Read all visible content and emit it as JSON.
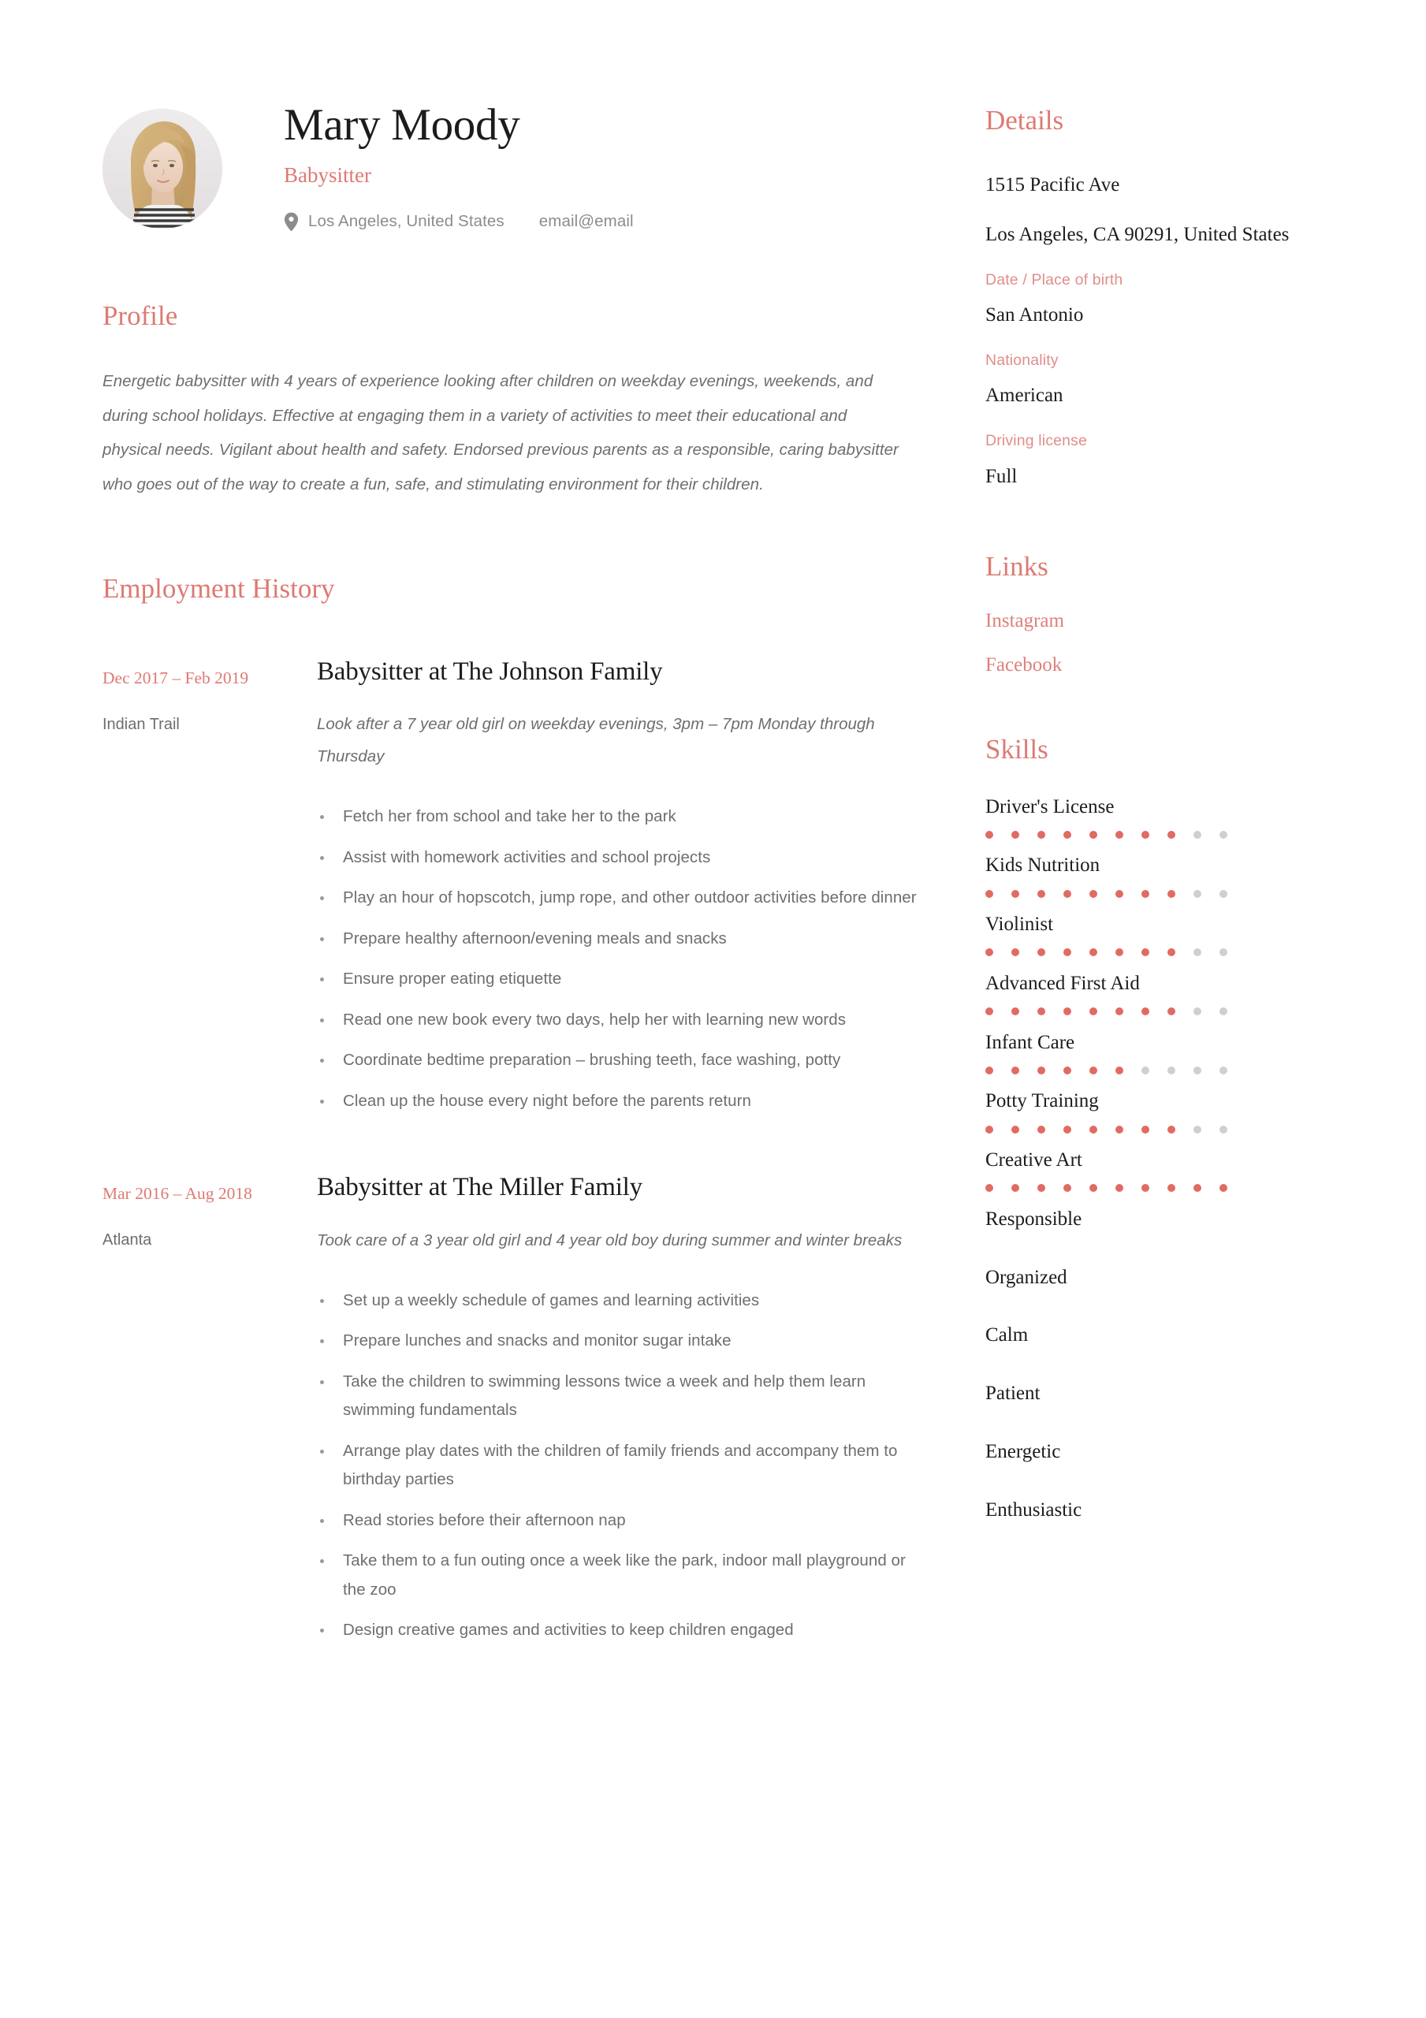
{
  "theme": {
    "accent": "#dd7a72",
    "accent_dot": "#e06b62",
    "dot_empty": "#cfcfcf",
    "text_dark": "#1c1c1c",
    "text_muted": "#6e6e6e"
  },
  "header": {
    "name": "Mary Moody",
    "job_title": "Babysitter",
    "location": "Los Angeles, United States",
    "email": "email@email",
    "location_icon": "map-pin-icon",
    "avatar_alt": "portrait-photo"
  },
  "profile": {
    "heading": "Profile",
    "body": "Energetic babysitter with 4 years of experience looking after children on weekday evenings, weekends, and during school holidays. Effective at engaging them in a variety of activities to meet their educational and physical needs. Vigilant about health and safety. Endorsed previous parents as a responsible, caring babysitter who goes out of the way to create a fun, safe, and stimulating environment for their children."
  },
  "employment": {
    "heading": "Employment History",
    "jobs": [
      {
        "dates": "Dec 2017 – Feb 2019",
        "location": "Indian Trail",
        "title": "Babysitter at The Johnson Family",
        "summary": "Look after a 7 year old girl on weekday evenings, 3pm – 7pm Monday through Thursday",
        "bullets": [
          "Fetch her from school and take her to the park",
          "Assist with homework activities and school projects",
          "Play an hour of hopscotch, jump rope, and other outdoor activities before dinner",
          "Prepare healthy afternoon/evening meals and snacks",
          "Ensure proper eating etiquette",
          "Read one new book every two days, help her with learning new words",
          "Coordinate bedtime preparation – brushing teeth, face washing, potty",
          "Clean up the house every night before the parents return"
        ]
      },
      {
        "dates": "Mar 2016 – Aug 2018",
        "location": "Atlanta",
        "title": "Babysitter at The Miller Family",
        "summary": "Took care of a 3 year old girl and 4 year old boy during summer and winter breaks",
        "bullets": [
          "Set up a weekly schedule of games and learning activities",
          "Prepare lunches and snacks and monitor sugar intake",
          "Take the children to swimming lessons twice a week and help them learn swimming fundamentals",
          "Arrange play dates with the children of family friends and accompany them to birthday parties",
          "Read stories before their afternoon nap",
          "Take them to a fun outing once a week like the park, indoor mall playground or the zoo",
          "Design creative games and activities to keep children engaged"
        ]
      }
    ]
  },
  "details": {
    "heading": "Details",
    "address_line1": "1515 Pacific Ave",
    "address_line2": "Los Angeles, CA 90291, United States",
    "dob_label": "Date / Place of birth",
    "dob_value": "San Antonio",
    "nationality_label": "Nationality",
    "nationality_value": "American",
    "license_label": "Driving license",
    "license_value": "Full"
  },
  "links": {
    "heading": "Links",
    "items": [
      {
        "label": "Instagram"
      },
      {
        "label": "Facebook"
      }
    ]
  },
  "skills": {
    "heading": "Skills",
    "max_dots": 10,
    "items": [
      {
        "name": "Driver's License",
        "level": 8,
        "has_rating": true
      },
      {
        "name": "Kids Nutrition",
        "level": 8,
        "has_rating": true
      },
      {
        "name": "Violinist",
        "level": 8,
        "has_rating": true
      },
      {
        "name": "Advanced First Aid",
        "level": 8,
        "has_rating": true
      },
      {
        "name": "Infant Care",
        "level": 6,
        "has_rating": true
      },
      {
        "name": "Potty Training",
        "level": 8,
        "has_rating": true
      },
      {
        "name": "Creative Art",
        "level": 10,
        "has_rating": true
      },
      {
        "name": "Responsible",
        "level": null,
        "has_rating": false
      },
      {
        "name": "Organized",
        "level": null,
        "has_rating": false
      },
      {
        "name": "Calm",
        "level": null,
        "has_rating": false
      },
      {
        "name": "Patient",
        "level": null,
        "has_rating": false
      },
      {
        "name": "Energetic",
        "level": null,
        "has_rating": false
      },
      {
        "name": "Enthusiastic",
        "level": null,
        "has_rating": false
      }
    ]
  }
}
